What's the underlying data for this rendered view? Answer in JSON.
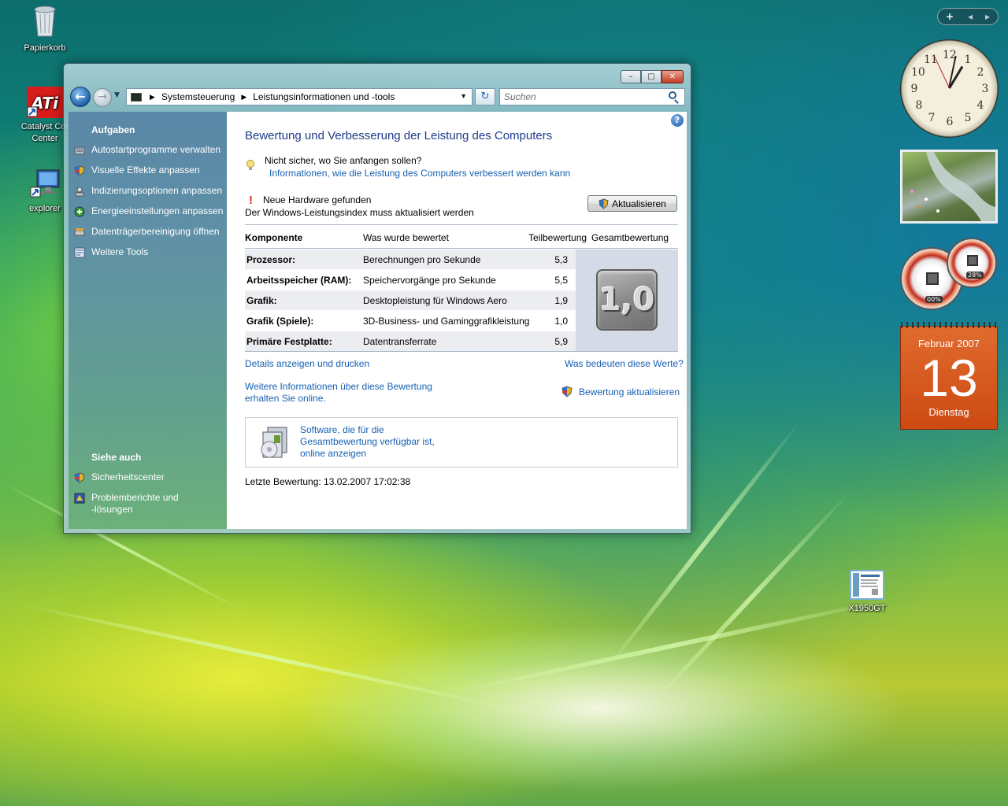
{
  "desktop": {
    "icons": [
      {
        "label": "Papierkorb"
      },
      {
        "label": "Catalyst Cor\nCenter"
      },
      {
        "label": "explorer"
      },
      {
        "label": "X1950GT"
      }
    ]
  },
  "window": {
    "controls": {
      "minimize": "–",
      "maximize": "□",
      "close": "✕"
    },
    "address": {
      "crumbs": [
        "Systemsteuerung",
        "Leistungsinformationen und -tools"
      ]
    },
    "search": {
      "placeholder": "Suchen"
    }
  },
  "sidebar": {
    "tasks_heading": "Aufgaben",
    "tasks": [
      {
        "label": "Autostartprogramme verwalten",
        "icon": "startup-icon"
      },
      {
        "label": "Visuelle Effekte anpassen",
        "icon": "shield-icon"
      },
      {
        "label": "Indizierungsoptionen anpassen",
        "icon": "indexing-icon"
      },
      {
        "label": "Energieeinstellungen anpassen",
        "icon": "power-icon"
      },
      {
        "label": "Datenträgerbereinigung öffnen",
        "icon": "disk-cleanup-icon"
      },
      {
        "label": "Weitere Tools",
        "icon": "tools-icon"
      }
    ],
    "see_also_heading": "Siehe auch",
    "see_also": [
      {
        "label": "Sicherheitscenter",
        "icon": "shield-icon"
      },
      {
        "label": "Problemberichte und\n-lösungen",
        "icon": "problem-reports-icon"
      }
    ]
  },
  "content": {
    "title": "Bewertung und Verbesserung der Leistung des Computers",
    "hint_question": "Nicht sicher, wo Sie anfangen sollen?",
    "hint_link": "Informationen, wie die Leistung des Computers verbessert werden kann",
    "hardware_notice": "Neue Hardware gefunden",
    "index_notice": "Der Windows-Leistungsindex muss aktualisiert werden",
    "update_button": "Aktualisieren",
    "table": {
      "headers": [
        "Komponente",
        "Was wurde bewertet",
        "Teilbewertung",
        "Gesamtbewertung"
      ],
      "rows": [
        {
          "component": "Prozessor:",
          "rated": "Berechnungen pro Sekunde",
          "score": "5,3"
        },
        {
          "component": "Arbeitsspeicher (RAM):",
          "rated": "Speichervorgänge pro Sekunde",
          "score": "5,5"
        },
        {
          "component": "Grafik:",
          "rated": "Desktopleistung für Windows Aero",
          "score": "1,9"
        },
        {
          "component": "Grafik (Spiele):",
          "rated": "3D-Business- und Gaminggrafikleistung",
          "score": "1,0"
        },
        {
          "component": "Primäre Festplatte:",
          "rated": "Datentransferrate",
          "score": "5,9"
        }
      ],
      "base_score": "1,0"
    },
    "details_link": "Details anzeigen und drucken",
    "meaning_link": "Was bedeuten diese Werte?",
    "more_info_link": "Weitere Informationen über diese Bewertung\nerhalten Sie online.",
    "refresh_rating_link": "Bewertung aktualisieren",
    "software_link": "Software, die für die\nGesamtbewertung verfügbar ist,\nonline anzeigen",
    "last_rating": "Letzte Bewertung: 13.02.2007 17:02:38"
  },
  "gadgets": {
    "toolbar": {
      "add": "+",
      "prev": "◂",
      "next": "▸"
    },
    "cpu_meter": {
      "cpu": "00%",
      "ram": "28%"
    },
    "calendar": {
      "month": "Februar 2007",
      "day": "13",
      "weekday": "Dienstag"
    }
  },
  "colors": {
    "link": "#1660b2",
    "title": "#1e3b8a",
    "calendar": "#d9561c"
  }
}
